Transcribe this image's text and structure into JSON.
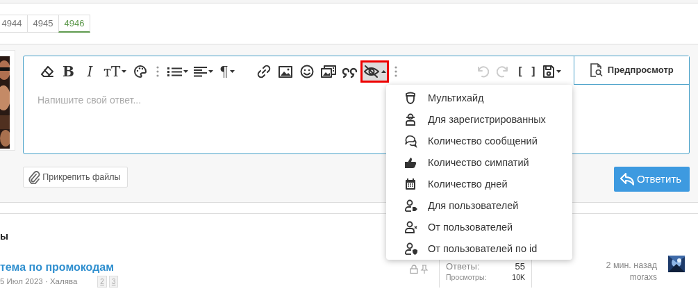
{
  "pagination": [
    {
      "label": "4944",
      "selected": false
    },
    {
      "label": "4945",
      "selected": false
    },
    {
      "label": "4946",
      "selected": true
    }
  ],
  "editor": {
    "toolbar_main": [
      {
        "kind": "button",
        "dropdown": false,
        "selected": false,
        "disabled": false
      },
      {
        "kind": "button",
        "text": "B",
        "dropdown": false,
        "selected": false,
        "disabled": false
      },
      {
        "kind": "button",
        "text": "I",
        "dropdown": false,
        "selected": false,
        "disabled": false
      },
      {
        "kind": "button",
        "text": "тT",
        "dropdown": true,
        "selected": false,
        "disabled": false
      },
      {
        "kind": "button",
        "dropdown": false,
        "selected": false,
        "disabled": false
      },
      {
        "kind": "separator"
      },
      {
        "kind": "button",
        "dropdown": true,
        "selected": false,
        "disabled": false
      },
      {
        "kind": "button",
        "dropdown": true,
        "selected": false,
        "disabled": false
      },
      {
        "kind": "button",
        "text": "¶",
        "dropdown": true,
        "selected": false,
        "disabled": false
      },
      {
        "kind": "gap"
      },
      {
        "kind": "button",
        "dropdown": false,
        "selected": false,
        "disabled": false
      },
      {
        "kind": "button",
        "dropdown": false,
        "selected": false,
        "disabled": false
      },
      {
        "kind": "button",
        "dropdown": false,
        "selected": false,
        "disabled": false
      },
      {
        "kind": "button",
        "dropdown": false,
        "selected": false,
        "disabled": false
      },
      {
        "kind": "button",
        "dropdown": false,
        "selected": false,
        "disabled": false
      },
      {
        "kind": "button",
        "dropdown": true,
        "selected": true,
        "disabled": false
      },
      {
        "kind": "separator"
      }
    ],
    "toolbar_history": [
      {
        "kind": "button",
        "dropdown": false,
        "selected": false,
        "disabled": true
      },
      {
        "kind": "button",
        "dropdown": false,
        "selected": false,
        "disabled": true
      },
      {
        "kind": "button",
        "text": "[ ]",
        "dropdown": false,
        "selected": false,
        "disabled": false
      },
      {
        "kind": "button",
        "dropdown": true,
        "selected": false,
        "disabled": false
      }
    ],
    "preview_tab": "Предпросмотр",
    "placeholder": "Напишите свой ответ...",
    "hide_menu": [
      {
        "label": "Мультихайд"
      },
      {
        "label": "Для зарегистрированных"
      },
      {
        "label": "Количество сообщений"
      },
      {
        "label": "Количество симпатий"
      },
      {
        "label": "Количество дней"
      },
      {
        "label": "Для пользователей"
      },
      {
        "label": "От пользователей"
      },
      {
        "label": "От пользователей по id"
      }
    ]
  },
  "attach_button": "Прикрепить файлы",
  "reply_button": "Ответить",
  "section_heading": "ы",
  "thread": {
    "title": "тема по промокодам",
    "meta": "5 Июл 2023 · Халява",
    "pages": [
      "2",
      "3"
    ],
    "stats": [
      {
        "label": "Ответы:",
        "value": "55"
      },
      {
        "label": "Просмотры:",
        "value": "10K"
      }
    ],
    "last_time": "2 мин. назад",
    "last_user": "moraxs"
  }
}
